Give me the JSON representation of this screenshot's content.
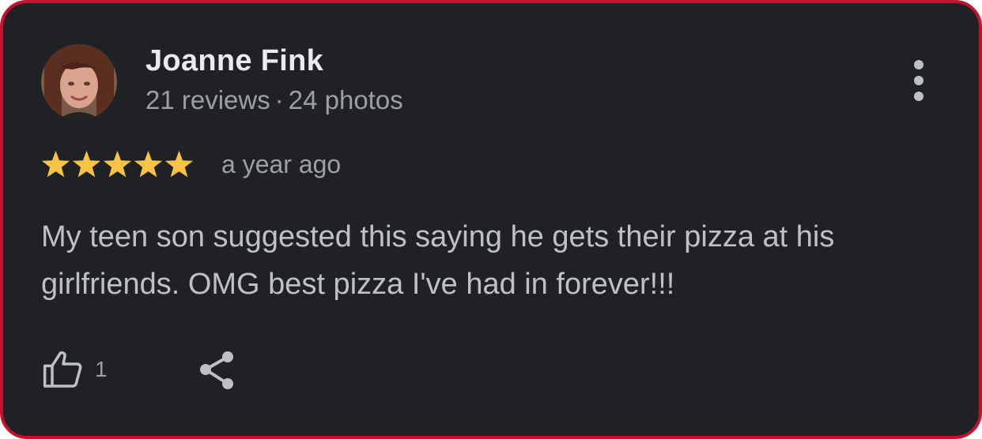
{
  "review": {
    "reviewer_name": "Joanne Fink",
    "reviewer_stats_reviews": "21 reviews",
    "reviewer_stats_separator": "·",
    "reviewer_stats_photos": "24 photos",
    "rating": 5,
    "rating_max": 5,
    "time": "a year ago",
    "text": "My teen son suggested this saying he gets their pizza at his girlfriends. OMG best pizza I've had in forever!!!",
    "like_count": "1"
  },
  "icons": {
    "more": "more-vert-icon",
    "like": "thumbs-up-icon",
    "share": "share-icon",
    "star": "star-icon"
  },
  "colors": {
    "card_background": "#202124",
    "border": "#c8102e",
    "star": "#f6c344",
    "name": "#e8eaed",
    "secondary_text": "#9aa0a6",
    "body_text": "#bdc1c6"
  }
}
